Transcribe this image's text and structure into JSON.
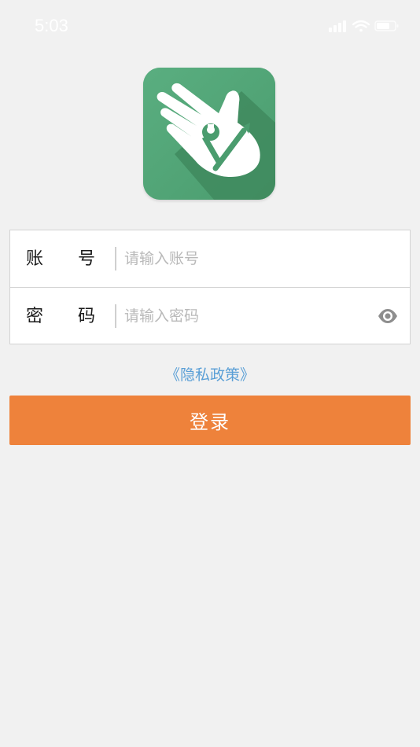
{
  "status_bar": {
    "time": "5:03"
  },
  "app": {
    "logo_icon": "hand-with-wrench-icon",
    "colors": {
      "logo_bg": "#52a677",
      "logo_shadow": "#3e8a5d",
      "accent": "#ee823b",
      "link": "#5a9fd6",
      "background": "#f1f1f1"
    }
  },
  "form": {
    "account": {
      "label_char_1": "账",
      "label_char_2": "号",
      "placeholder": "请输入账号",
      "value": ""
    },
    "password": {
      "label_char_1": "密",
      "label_char_2": "码",
      "placeholder": "请输入密码",
      "value": "",
      "toggle_icon": "eye-icon"
    }
  },
  "privacy_link": "《隐私政策》",
  "login_button": "登录"
}
